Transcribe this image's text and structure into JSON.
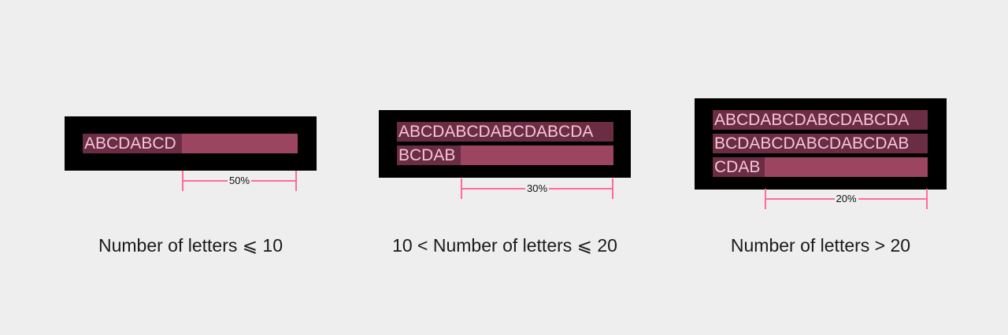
{
  "colors": {
    "background": "#eeeeee",
    "panel": "#000000",
    "text_highlight": "#6b2d44",
    "extra_fill": "#9b4560",
    "text": "#f6c4d8",
    "measure": "#ff6b9d"
  },
  "examples": [
    {
      "lines": [
        "ABCDABCD"
      ],
      "extra_percent": "50%",
      "extra_fraction": 0.5,
      "caption": "Number of letters ⩽ 10"
    },
    {
      "lines": [
        "ABCDABCDABCDABCDA",
        "BCDAB"
      ],
      "extra_percent": "30%",
      "extra_fraction": 0.3,
      "caption": "10 < Number of letters ⩽ 20"
    },
    {
      "lines": [
        "ABCDABCDABCDABCDA",
        "BCDABCDABCDABCDAB",
        "CDAB"
      ],
      "extra_percent": "20%",
      "extra_fraction": 0.2,
      "caption": "Number of letters > 20"
    }
  ]
}
